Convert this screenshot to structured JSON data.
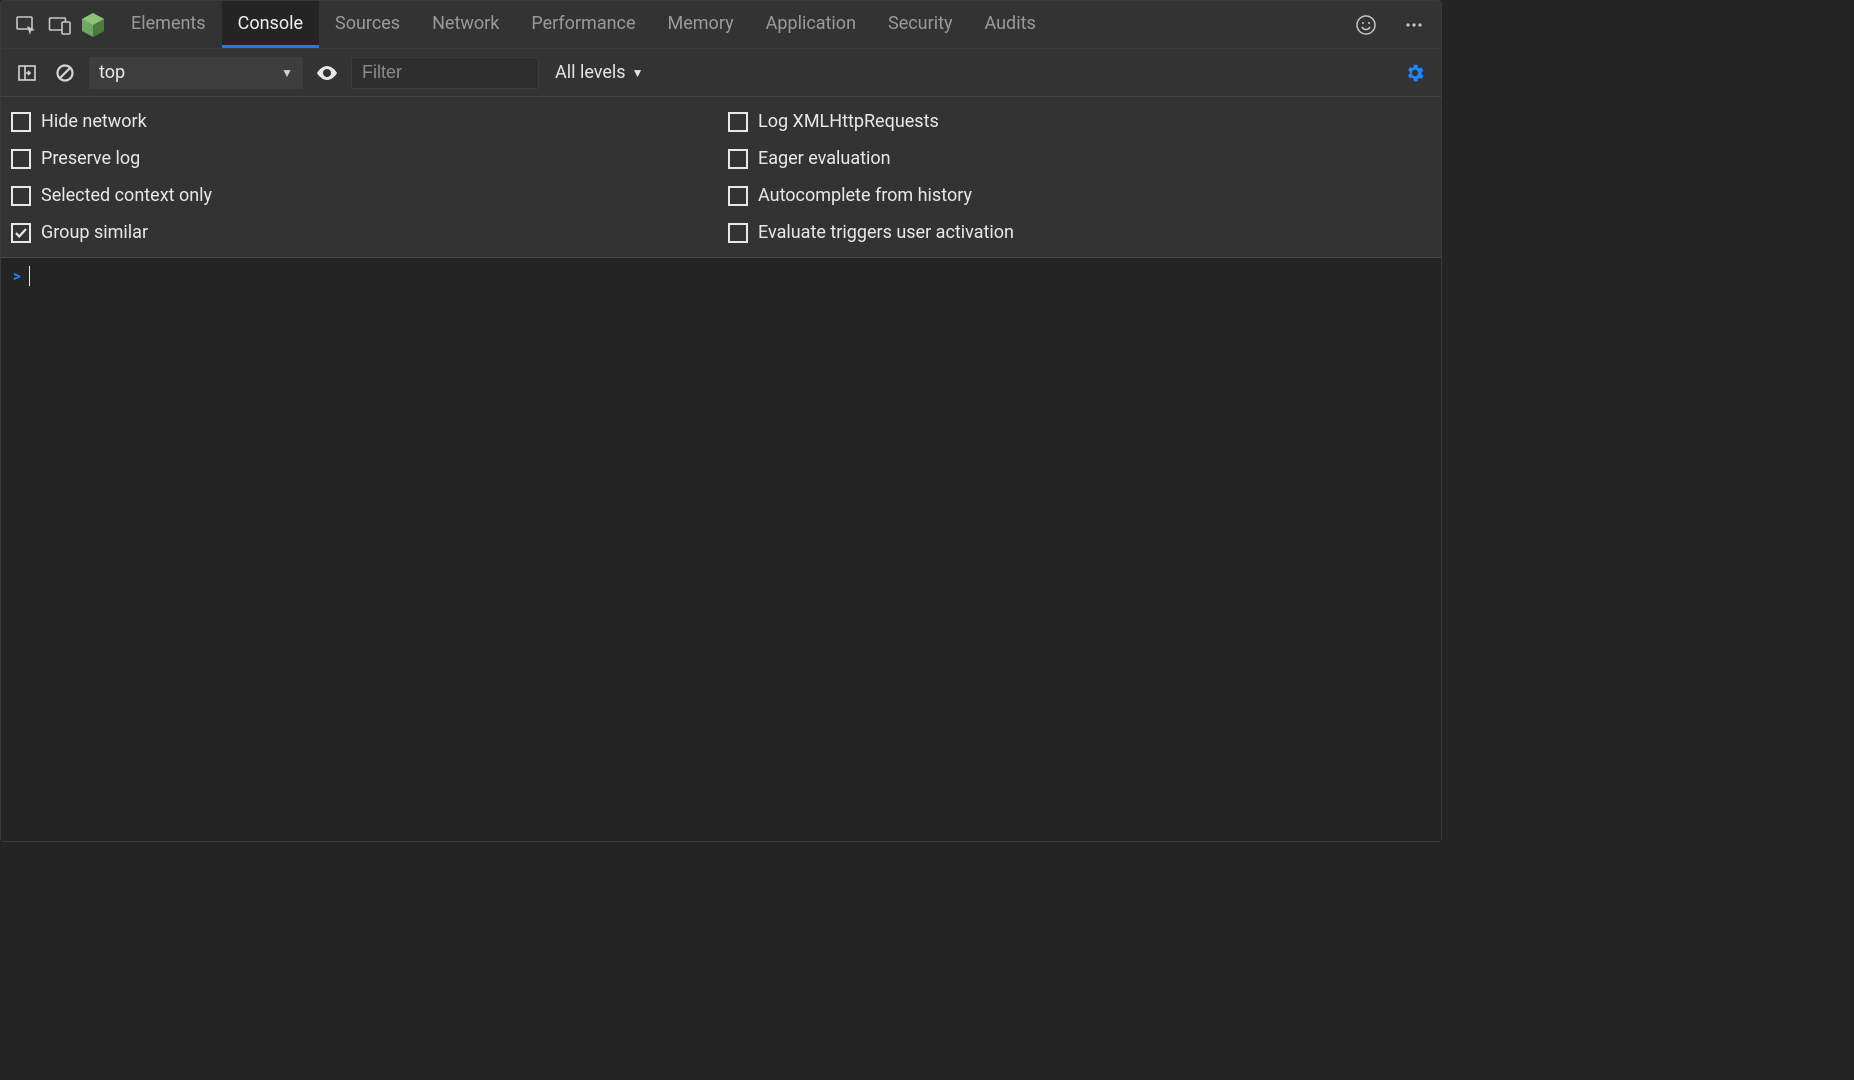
{
  "topbar": {
    "tabs": [
      "Elements",
      "Console",
      "Sources",
      "Network",
      "Performance",
      "Memory",
      "Application",
      "Security",
      "Audits"
    ],
    "active_tab_index": 1
  },
  "toolbar": {
    "context_value": "top",
    "filter_placeholder": "Filter",
    "levels_label": "All levels"
  },
  "settings": {
    "left": [
      {
        "label": "Hide network",
        "checked": false
      },
      {
        "label": "Preserve log",
        "checked": false
      },
      {
        "label": "Selected context only",
        "checked": false
      },
      {
        "label": "Group similar",
        "checked": true
      }
    ],
    "right": [
      {
        "label": "Log XMLHttpRequests",
        "checked": false
      },
      {
        "label": "Eager evaluation",
        "checked": false
      },
      {
        "label": "Autocomplete from history",
        "checked": false
      },
      {
        "label": "Evaluate triggers user activation",
        "checked": false
      }
    ]
  },
  "console": {
    "prompt": ">"
  }
}
